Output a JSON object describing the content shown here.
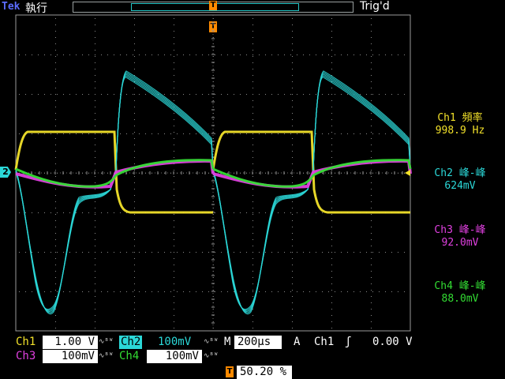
{
  "header": {
    "brand": "Tek",
    "mode": "執行",
    "trigger_status": "Trig'd"
  },
  "measurements": [
    {
      "label": "Ch1 頻率",
      "value": "998.9 Hz",
      "color": "#f2e12a"
    },
    {
      "label": "Ch2 峰-峰",
      "value": "624mV",
      "color": "#2bd8d8"
    },
    {
      "label": "Ch3 峰-峰",
      "value": "92.0mV",
      "color": "#e040e0"
    },
    {
      "label": "Ch4 峰-峰",
      "value": "88.0mV",
      "color": "#33dd33"
    }
  ],
  "channels": {
    "ch1": {
      "name": "Ch1",
      "scale": "1.00 V",
      "color": "#f2e12a"
    },
    "ch2": {
      "name": "Ch2",
      "scale": "100mV",
      "color": "#2bd8d8"
    },
    "ch3": {
      "name": "Ch3",
      "scale": "100mV",
      "color": "#e040e0"
    },
    "ch4": {
      "name": "Ch4",
      "scale": "100mV",
      "color": "#33dd33"
    }
  },
  "channel2_marker": "2",
  "timebase": {
    "label": "M",
    "value": "200µs"
  },
  "trigger": {
    "mode": "A",
    "source": "Ch1",
    "slope_icon": "rising-edge-icon",
    "slope_glyph": "ʃ",
    "level": "0.00 V",
    "position_marker": "T",
    "position": "50.20 %"
  },
  "bandwidth_symbol": "∿ᴮᵂ"
}
